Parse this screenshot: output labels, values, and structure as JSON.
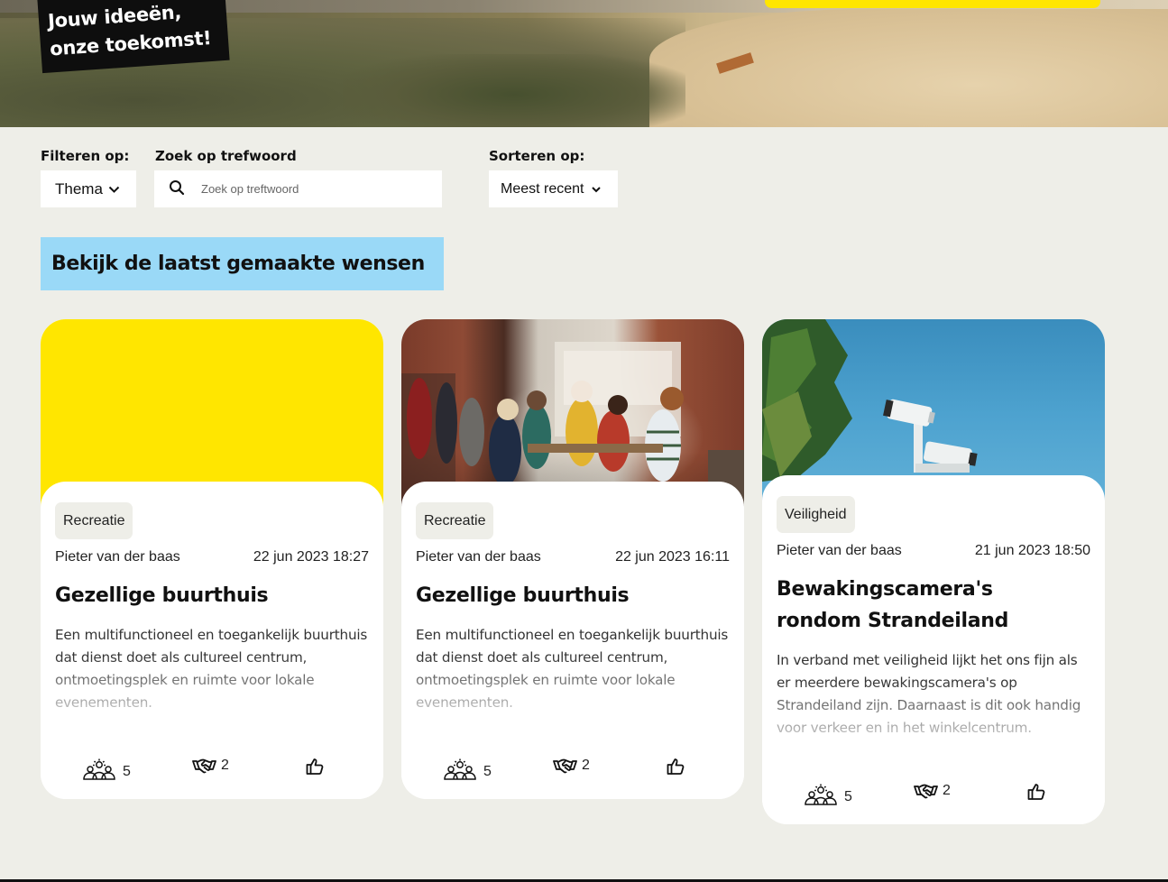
{
  "hero": {
    "stamp_line1": "Jouw ideeën,",
    "stamp_line2": "onze toekomst!"
  },
  "filters": {
    "filter_label": "Filteren op:",
    "theme_value": "Thema",
    "search_label": "Zoek op trefwoord",
    "search_placeholder": "Zoek op treftwoord",
    "sort_label": "Sorteren op:",
    "sort_value": "Meest recent"
  },
  "section": {
    "title": "Bekijk de laatst gemaakte wensen"
  },
  "cards": [
    {
      "tag": "Recreatie",
      "author": "Pieter van der baas",
      "date": "22 jun 2023 18:27",
      "title": "Gezellige buurthuis",
      "description": "Een multifunctioneel en toegankelijk buurthuis dat dienst doet als cultureel centrum, ontmoetingsplek en ruimte voor lokale evenementen.",
      "supporters": "5",
      "collaborators": "2",
      "image": "yellow-placeholder"
    },
    {
      "tag": "Recreatie",
      "author": "Pieter van der baas",
      "date": "22 jun 2023 16:11",
      "title": "Gezellige buurthuis",
      "description": "Een multifunctioneel en toegankelijk buurthuis dat dienst doet als cultureel centrum, ontmoetingsplek en ruimte voor lokale evenementen.",
      "supporters": "5",
      "collaborators": "2",
      "image": "community-center-photo"
    },
    {
      "tag": "Veiligheid",
      "author": "Pieter van der baas",
      "date": "21 jun 2023 18:50",
      "title": "Bewakingscamera's rondom Strandeiland",
      "description": "In verband met veiligheid lijkt het ons fijn als er meerdere bewakingscamera's op Strandeiland zijn. Daarnaast is dit ook handig voor verkeer en in het winkelcentrum.",
      "supporters": "5",
      "collaborators": "2",
      "image": "security-camera-photo"
    }
  ],
  "colors": {
    "page_bg": "#eeeee8",
    "accent_yellow": "#ffe600",
    "heading_blue": "#9ad9f7",
    "stamp_black": "#0e0e0e"
  },
  "icons": {
    "supporters": "people-sun-icon",
    "collaborators": "handshake-icon",
    "like": "thumbs-up-icon",
    "search": "search-icon",
    "dropdown": "chevron-down-icon"
  }
}
